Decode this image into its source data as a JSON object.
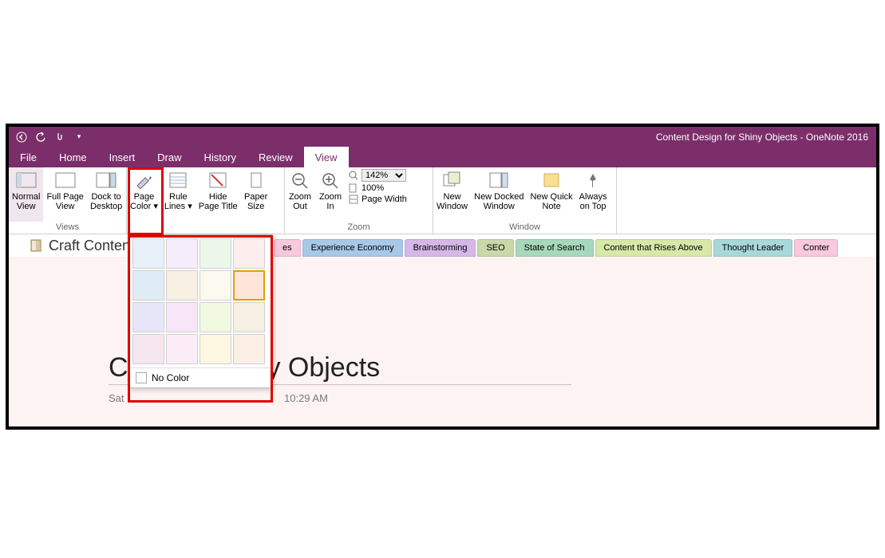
{
  "titlebar": {
    "title": "Content Design for Shiny Objects  -  OneNote 2016"
  },
  "menu": {
    "file": "File",
    "home": "Home",
    "insert": "Insert",
    "draw": "Draw",
    "history": "History",
    "review": "Review",
    "view": "View"
  },
  "ribbon": {
    "views": {
      "label": "Views",
      "normal": "Normal\nView",
      "fullpage": "Full Page\nView",
      "dock": "Dock to\nDesktop"
    },
    "page_setup": {
      "page_color": "Page\nColor ▾",
      "rule_lines": "Rule\nLines ▾",
      "hide_title": "Hide\nPage Title",
      "paper_size": "Paper\nSize"
    },
    "zoom": {
      "label": "Zoom",
      "out": "Zoom\nOut",
      "in": "Zoom\nIn",
      "percent": "142%",
      "hundred": "100%",
      "width": "Page Width"
    },
    "window": {
      "label": "Window",
      "new": "New\nWindow",
      "docked": "New Docked\nWindow",
      "quick": "New Quick\nNote",
      "ontop": "Always\non Top"
    }
  },
  "notebook": {
    "name": "Craft Content"
  },
  "tabs": [
    {
      "label": "es",
      "color": "#f8c8dc"
    },
    {
      "label": "Experience Economy",
      "color": "#a8c8e8"
    },
    {
      "label": "Brainstorming",
      "color": "#d6b8e8"
    },
    {
      "label": "SEO",
      "color": "#c8d8a8"
    },
    {
      "label": "State of Search",
      "color": "#a8d8bc"
    },
    {
      "label": "Content that Rises Above",
      "color": "#d8e8a8"
    },
    {
      "label": "Thought Leader",
      "color": "#a8d8d8"
    },
    {
      "label": "Conter",
      "color": "#f8c8dc"
    }
  ],
  "page": {
    "title_visible": "C                    gn for Shiny Objects",
    "date": "Sat",
    "time": "10:29 AM"
  },
  "color_dropdown": {
    "colors": [
      "#e8f0fa",
      "#f5ecfc",
      "#ecf7ec",
      "#fdeeee",
      "#e0ecf5",
      "#f9f0e4",
      "#fbf9f0",
      "#fde6d9",
      "#e6e6f8",
      "#f8e6f8",
      "#f0f8e0",
      "#f5efe4",
      "#f5e6f0",
      "#fbecf7",
      "#fdf6e0",
      "#fcefe6"
    ],
    "selected_index": 7,
    "no_color": "No Color"
  }
}
